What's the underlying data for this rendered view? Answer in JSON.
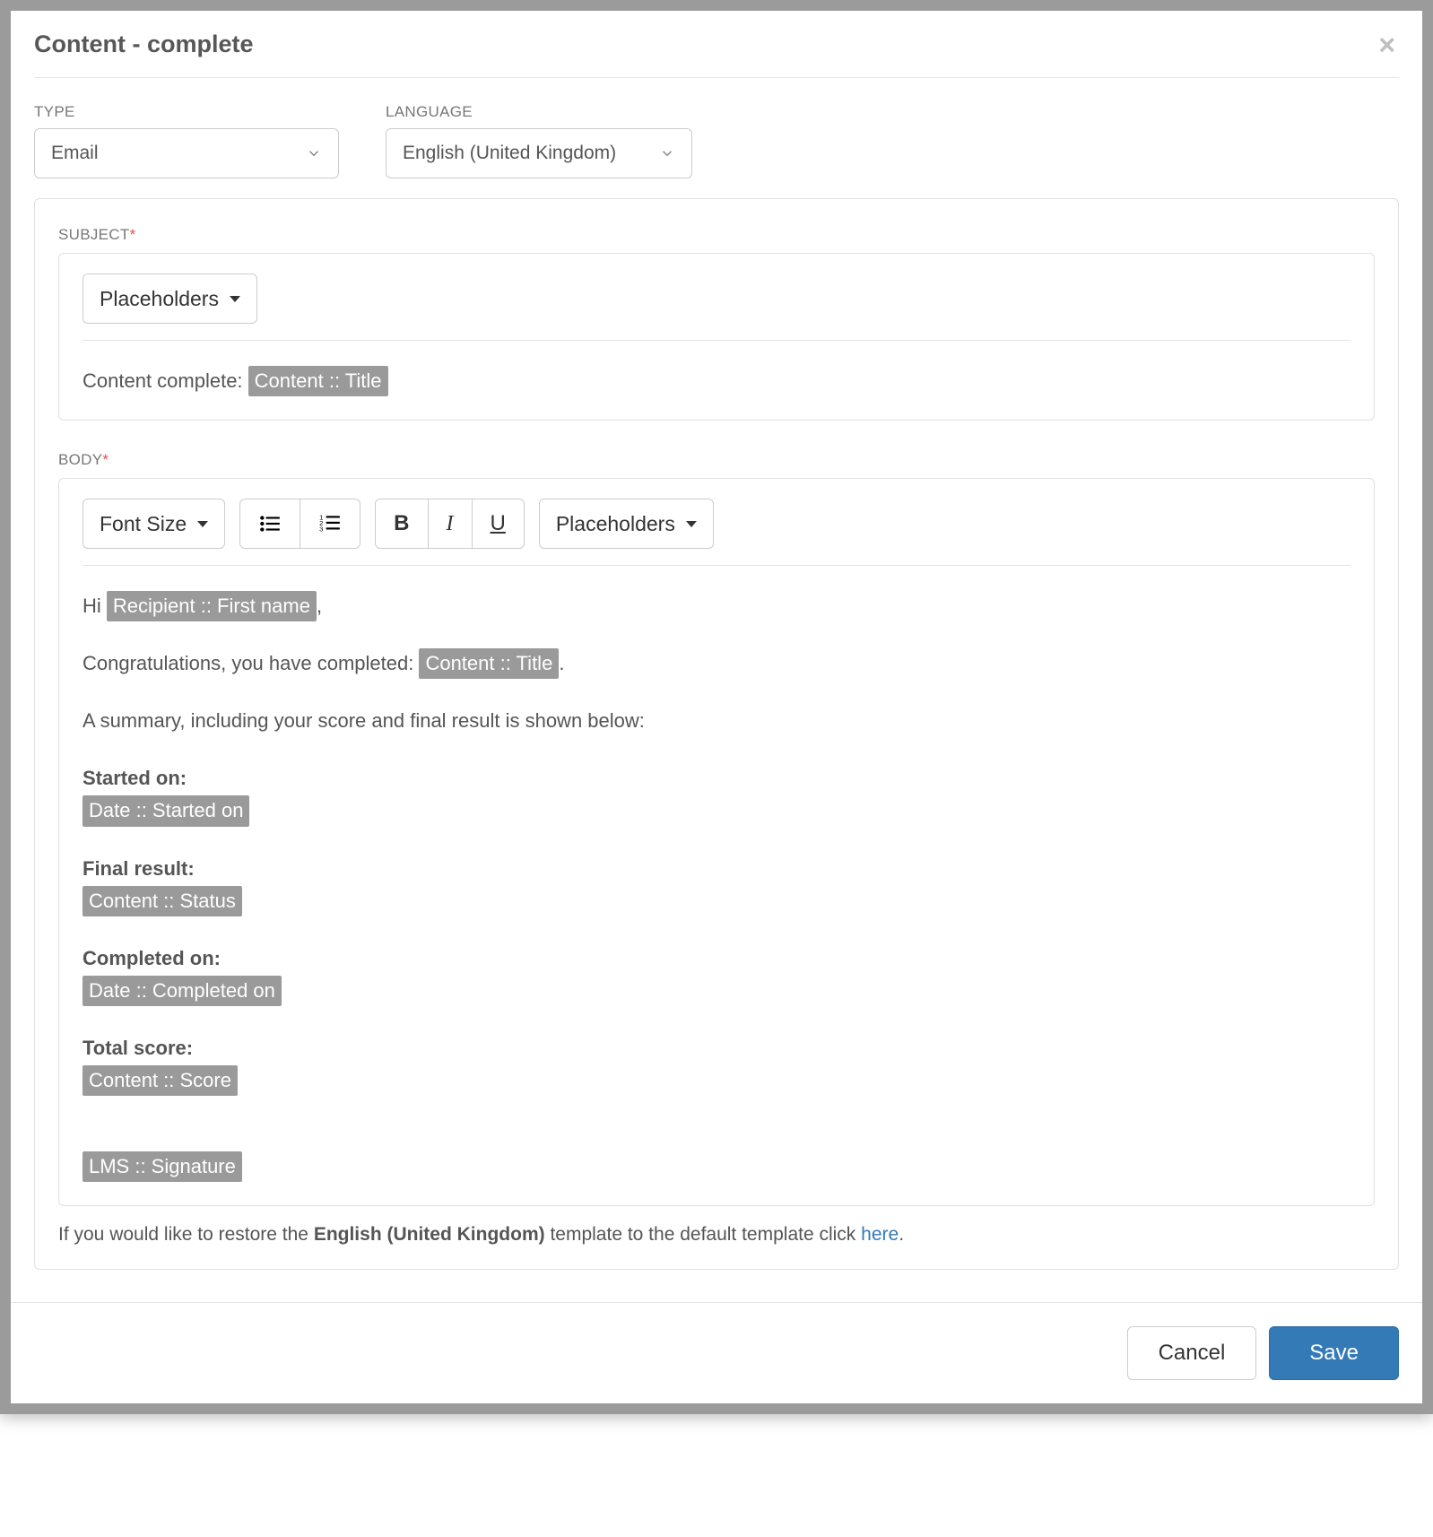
{
  "modal": {
    "title": "Content - complete"
  },
  "fields": {
    "type_label": "TYPE",
    "type_value": "Email",
    "language_label": "LANGUAGE",
    "language_value": "English (United Kingdom)"
  },
  "subject": {
    "label": "SUBJECT",
    "placeholders_btn": "Placeholders",
    "prefix_text": "Content complete: ",
    "placeholder_chip": "Content :: Title"
  },
  "body": {
    "label": "BODY",
    "font_size_btn": "Font Size",
    "placeholders_btn": "Placeholders",
    "bold_label": "B",
    "italic_label": "I",
    "underline_label": "U",
    "greeting_prefix": "Hi ",
    "greeting_ph": "Recipient :: First name",
    "greeting_suffix": ",",
    "congrats_prefix": "Congratulations, you have completed: ",
    "congrats_ph": "Content :: Title",
    "congrats_suffix": ".",
    "summary_line": "A summary, including your score and final result is shown below:",
    "started_label": "Started on:",
    "started_ph": "Date :: Started on",
    "result_label": "Final result:",
    "result_ph": "Content :: Status",
    "completed_label": "Completed on:",
    "completed_ph": "Date :: Completed on",
    "score_label": "Total score:",
    "score_ph": "Content :: Score",
    "signature_ph": "LMS :: Signature"
  },
  "restore": {
    "prefix": "If you would like to restore the ",
    "bold_part": "English (United Kingdom)",
    "middle": " template to the default template click ",
    "link": "here",
    "suffix": "."
  },
  "footer": {
    "cancel": "Cancel",
    "save": "Save"
  }
}
